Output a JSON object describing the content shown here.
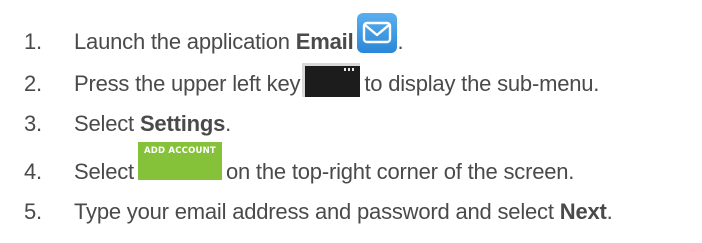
{
  "steps": [
    {
      "number": "1.",
      "before": "Launch the application ",
      "bold": "Email",
      "icon": "email-envelope-icon",
      "after": "."
    },
    {
      "number": "2.",
      "before": "Press the upper left key",
      "icon": "menu-key-icon",
      "after": "to display the sub-menu."
    },
    {
      "number": "3.",
      "before": "Select ",
      "bold": "Settings",
      "after": "."
    },
    {
      "number": "4.",
      "before": "Select",
      "button_label": "ADD ACCOUNT",
      "after": "on the top-right corner of the screen."
    },
    {
      "number": "5.",
      "before": "Type your email address and password and select ",
      "bold": "Next",
      "after": "."
    }
  ],
  "colors": {
    "text": "#4a4a4a",
    "add_account_button": "#86c13a",
    "email_icon": "#3a97e0"
  }
}
